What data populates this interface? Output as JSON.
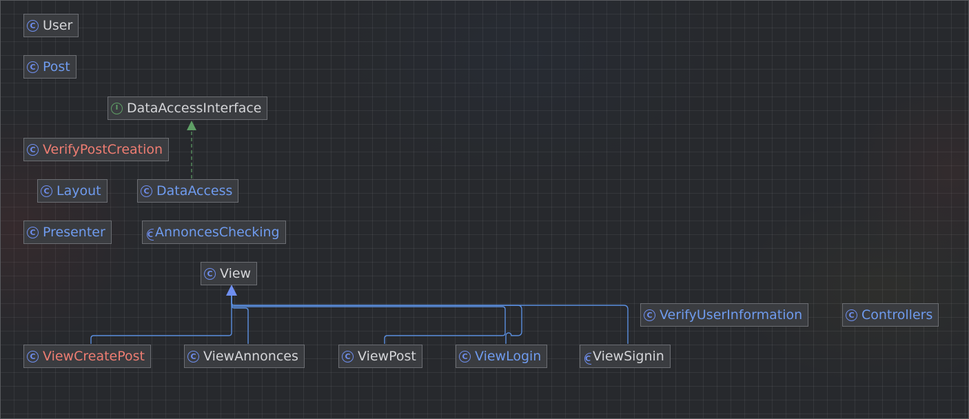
{
  "diagram": {
    "nodes": [
      {
        "id": "user",
        "label": "User",
        "kind": "class",
        "color": "gray"
      },
      {
        "id": "post",
        "label": "Post",
        "kind": "class",
        "color": "blue"
      },
      {
        "id": "data-access-interface",
        "label": "DataAccessInterface",
        "kind": "interface",
        "color": "gray"
      },
      {
        "id": "verify-post-creation",
        "label": "VerifyPostCreation",
        "kind": "class",
        "color": "red"
      },
      {
        "id": "layout",
        "label": "Layout",
        "kind": "class",
        "color": "blue"
      },
      {
        "id": "data-access",
        "label": "DataAccess",
        "kind": "class",
        "color": "blue"
      },
      {
        "id": "presenter",
        "label": "Presenter",
        "kind": "class",
        "color": "blue"
      },
      {
        "id": "annonces-checking",
        "label": "AnnoncesChecking",
        "kind": "class",
        "color": "blue"
      },
      {
        "id": "view",
        "label": "View",
        "kind": "class",
        "color": "gray"
      },
      {
        "id": "verify-user-information",
        "label": "VerifyUserInformation",
        "kind": "class",
        "color": "blue"
      },
      {
        "id": "controllers",
        "label": "Controllers",
        "kind": "class",
        "color": "blue"
      },
      {
        "id": "view-create-post",
        "label": "ViewCreatePost",
        "kind": "class",
        "color": "red"
      },
      {
        "id": "view-annonces",
        "label": "ViewAnnonces",
        "kind": "class",
        "color": "gray"
      },
      {
        "id": "view-post",
        "label": "ViewPost",
        "kind": "class",
        "color": "gray"
      },
      {
        "id": "view-login",
        "label": "ViewLogin",
        "kind": "class",
        "color": "blue"
      },
      {
        "id": "view-signin",
        "label": "ViewSignin",
        "kind": "class",
        "color": "gray"
      }
    ],
    "edges": [
      {
        "from": "data-access",
        "to": "data-access-interface",
        "type": "realization"
      },
      {
        "from": "view-create-post",
        "to": "view",
        "type": "generalization"
      },
      {
        "from": "view-annonces",
        "to": "view",
        "type": "generalization"
      },
      {
        "from": "view-post",
        "to": "view",
        "type": "generalization"
      },
      {
        "from": "view-login",
        "to": "view",
        "type": "generalization"
      },
      {
        "from": "view-signin",
        "to": "view",
        "type": "generalization"
      }
    ],
    "colors": {
      "blue": "#6f9bee",
      "red": "#ee7d72",
      "gray": "#d4d5d8",
      "generalization_edge": "#5b8fe0",
      "realization_edge": "#5fa066"
    }
  }
}
